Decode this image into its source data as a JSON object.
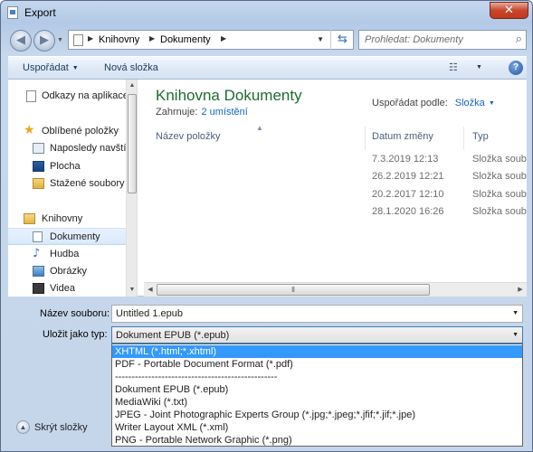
{
  "window": {
    "title": "Export",
    "close_glyph": "✕"
  },
  "address": {
    "crumbs": [
      "Knihovny",
      "Dokumenty"
    ],
    "search_placeholder": "Prohledat: Dokumenty"
  },
  "toolbar": {
    "organize_label": "Uspořádat",
    "new_folder_label": "Nová složka"
  },
  "sidebar": {
    "items": [
      {
        "label": "Odkazy na aplikace",
        "icon": "page-icon"
      },
      {
        "label": "Oblíbené položky",
        "icon": "star-icon"
      },
      {
        "label": "Naposledy navštívené",
        "icon": "recent-icon"
      },
      {
        "label": "Plocha",
        "icon": "desktop-icon"
      },
      {
        "label": "Stažené soubory",
        "icon": "download-folder-icon"
      },
      {
        "label": "Knihovny",
        "icon": "libraries-icon"
      },
      {
        "label": "Dokumenty",
        "icon": "documents-icon"
      },
      {
        "label": "Hudba",
        "icon": "music-icon"
      },
      {
        "label": "Obrázky",
        "icon": "pictures-icon"
      },
      {
        "label": "Videa",
        "icon": "videos-icon"
      }
    ]
  },
  "library": {
    "title": "Knihovna Dokumenty",
    "includes_label": "Zahrnuje:",
    "includes_link": "2 umístění",
    "arrange_label": "Uspořádat podle:",
    "arrange_value": "Složka"
  },
  "columns": {
    "name": "Název položky",
    "date": "Datum změny",
    "type": "Typ"
  },
  "rows": [
    {
      "date": "7.3.2019 12:13",
      "type": "Složka souborů"
    },
    {
      "date": "26.2.2019 12:21",
      "type": "Složka souborů"
    },
    {
      "date": "20.2.2017 12:10",
      "type": "Složka souborů"
    },
    {
      "date": "28.1.2020 16:26",
      "type": "Složka souborů"
    }
  ],
  "form": {
    "filename_label": "Název souboru:",
    "filename_value": "Untitled 1.epub",
    "filetype_label": "Uložit jako typ:",
    "filetype_value": "Dokument EPUB (*.epub)"
  },
  "filetype_options": [
    "XHTML (*.html;*.xhtml)",
    "PDF - Portable Document Format (*.pdf)",
    "-------------------------------------------------",
    "Dokument EPUB (*.epub)",
    "MediaWiki (*.txt)",
    "JPEG - Joint Photographic Experts Group (*.jpg;*.jpeg;*.jfif;*.jif;*.jpe)",
    "Writer Layout XML (*.xml)",
    "PNG - Portable Network Graphic (*.png)"
  ],
  "footer": {
    "hide_folders_label": "Skrýt složky"
  },
  "colors": {
    "library_title": "#1e6c2f",
    "link": "#1665c1",
    "highlight": "#3399ff"
  }
}
